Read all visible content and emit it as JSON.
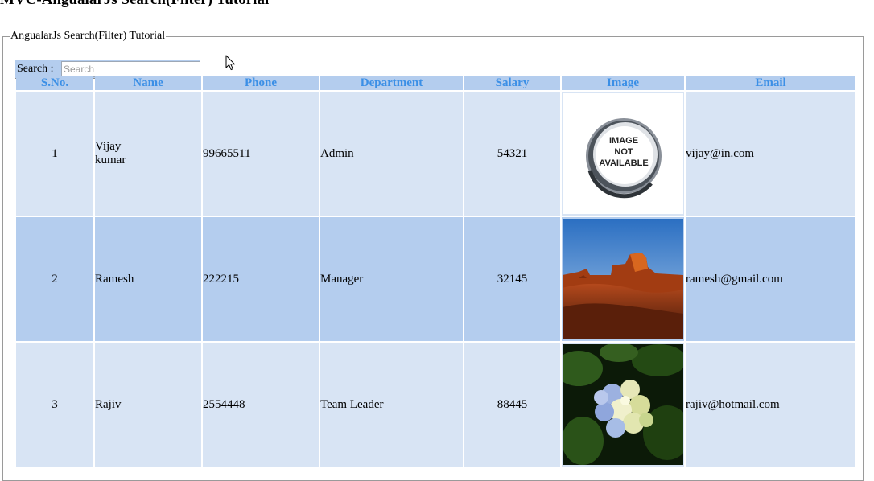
{
  "page": {
    "title": "MVC-AngualarJs Search(Filter) Tutorial"
  },
  "fieldset": {
    "legend": "AngualarJs Search(Filter) Tutorial"
  },
  "search": {
    "label": "Search :",
    "placeholder": "Search",
    "value": ""
  },
  "table": {
    "headers": [
      "S.No.",
      "Name",
      "Phone",
      "Department",
      "Salary",
      "Image",
      "Email"
    ],
    "rows": [
      {
        "sno": "1",
        "name": "Vijay kumar",
        "phone": "99665511",
        "department": "Admin",
        "salary": "54321",
        "image": "image-not-available",
        "email": "vijay@in.com"
      },
      {
        "sno": "2",
        "name": "Ramesh",
        "phone": "222215",
        "department": "Manager",
        "salary": "32145",
        "image": "desert-landscape",
        "email": "ramesh@gmail.com"
      },
      {
        "sno": "3",
        "name": "Rajiv",
        "phone": "2554448",
        "department": "Team Leader",
        "salary": "88445",
        "image": "hydrangea-flower",
        "email": "rajiv@hotmail.com"
      }
    ],
    "image_placeholder_text": [
      "IMAGE",
      "NOT",
      "AVAILABLE"
    ]
  },
  "colors": {
    "header_bg": "#b4cdee",
    "header_text": "#3b8fe6",
    "row_odd": "#d8e4f4",
    "row_even": "#b4cdee"
  }
}
